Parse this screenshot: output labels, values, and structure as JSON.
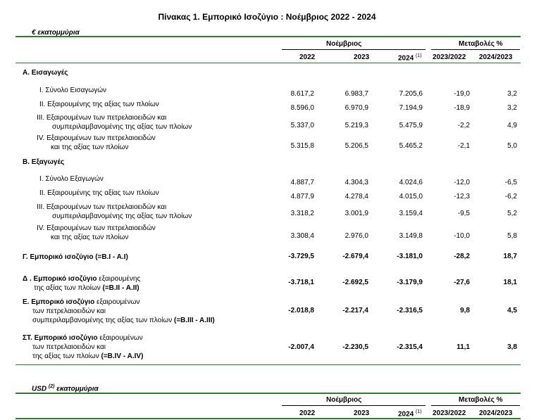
{
  "title": "Πίνακας 1. Εμπορικό Ισοζύγιο :  Νοέμβριος 2022  - 2024",
  "unit_eur": "€ εκατομμύρια",
  "unit_usd_prefix": "USD",
  "unit_usd_sup": "(2)",
  "unit_usd_suffix": "εκατομμύρια",
  "header": {
    "month": "Νοέμβριος",
    "changes": "Μεταβολές %",
    "y2022": "2022",
    "y2023": "2023",
    "y2024": "2024",
    "y2024_sup": "(1)",
    "c1": "2023/2022",
    "c2": "2024/2023"
  },
  "sections": {
    "A": "Α. Εισαγωγές",
    "B": "Β. Εξαγωγές"
  },
  "rows": [
    {
      "label1": "I.  Σύνολο Εισαγωγών",
      "label2": "",
      "v": [
        "8.617,2",
        "6.983,7",
        "7.205,6",
        "-19,0",
        "3,2"
      ]
    },
    {
      "label1": "II.  Εξαιρουμένης  της αξίας των πλοίων",
      "label2": "",
      "v": [
        "8.596,0",
        "6.970,9",
        "7.194,9",
        "-18,9",
        "3,2"
      ]
    },
    {
      "label1": "III. Εξαιρουμένων των πετρελαιοειδών και",
      "label2": "συμπεριλαμβανομένης της αξίας των πλοίων",
      "v": [
        "5.337,0",
        "5.219,3",
        "5.475,9",
        "-2,2",
        "4,9"
      ]
    },
    {
      "label1": "IV. Εξαιρουμένων των πετρελαιοειδών",
      "label2": "και της αξίας των πλοίων",
      "v": [
        "5.315,8",
        "5.206,5",
        "5.465,2",
        "-2,1",
        "5,0"
      ]
    },
    {
      "label1": "I.  Σύνολο Εξαγωγών",
      "label2": "",
      "v": [
        "4.887,7",
        "4.304,3",
        "4.024,6",
        "-12,0",
        "-6,5"
      ]
    },
    {
      "label1": "II.  Εξαιρουμένης  της αξίας των πλοίων",
      "label2": "",
      "v": [
        "4.877,9",
        "4.278,4",
        "4.015,0",
        "-12,3",
        "-6,2"
      ]
    },
    {
      "label1": "III. Εξαιρουμένων των πετρελαιοειδών και",
      "label2": "συμπεριλαμβανομένης της αξίας των πλοίων",
      "v": [
        "3.318,2",
        "3.001,9",
        "3.159,4",
        "-9,5",
        "5,2"
      ]
    },
    {
      "label1": "IV. Εξαιρουμένων των πετρελαιοειδών",
      "label2": "και της αξίας των πλοίων",
      "v": [
        "3.308,4",
        "2.976,0",
        "3.149,8",
        "-10,0",
        "5,8"
      ]
    }
  ],
  "balance": [
    {
      "l1_bold": "Γ. Εμπορικό ισοζύγιο (=B.I - A.I)",
      "l1_rest": "",
      "l2": "",
      "l2_bold": "",
      "l3": "",
      "l3_bold": "",
      "v": [
        "-3.729,5",
        "-2.679,4",
        "-3.181,0",
        "-28,2",
        "18,7"
      ]
    },
    {
      "l1_bold": "Δ . Εμπορικό ισοζύγιο",
      "l1_rest": " εξαιρουμένης",
      "l2": "της αξίας των πλοίων ",
      "l2_bold": "(=B.II - A.II)",
      "l3": "",
      "l3_bold": "",
      "v": [
        "-3.718,1",
        "-2.692,5",
        "-3.179,9",
        "-27,6",
        "18,1"
      ]
    },
    {
      "l1_bold": "Ε. Εμπορικό ισοζύγιο",
      "l1_rest": " εξαιρουμένων",
      "l2": "των πετρελαιοειδών και",
      "l2_bold": "",
      "l3": "συμπεριλαμβανομένης της αξίας των πλοίων ",
      "l3_bold": "(=B.III - A.III)",
      "v": [
        "-2.018,8",
        "-2.217,4",
        "-2.316,5",
        "9,8",
        "4,5"
      ]
    },
    {
      "l1_bold": "ΣΤ. Εμπορικό ισοζύγιο",
      "l1_rest": " εξαιρουμένων",
      "l2": "των πετρελαιοειδών και",
      "l2_bold": "",
      "l3": "της αξίας των πλοίων ",
      "l3_bold": "(=B.IV - A.IV)",
      "v": [
        "-2.007,4",
        "-2.230,5",
        "-2.315,4",
        "11,1",
        "3,8"
      ]
    }
  ]
}
